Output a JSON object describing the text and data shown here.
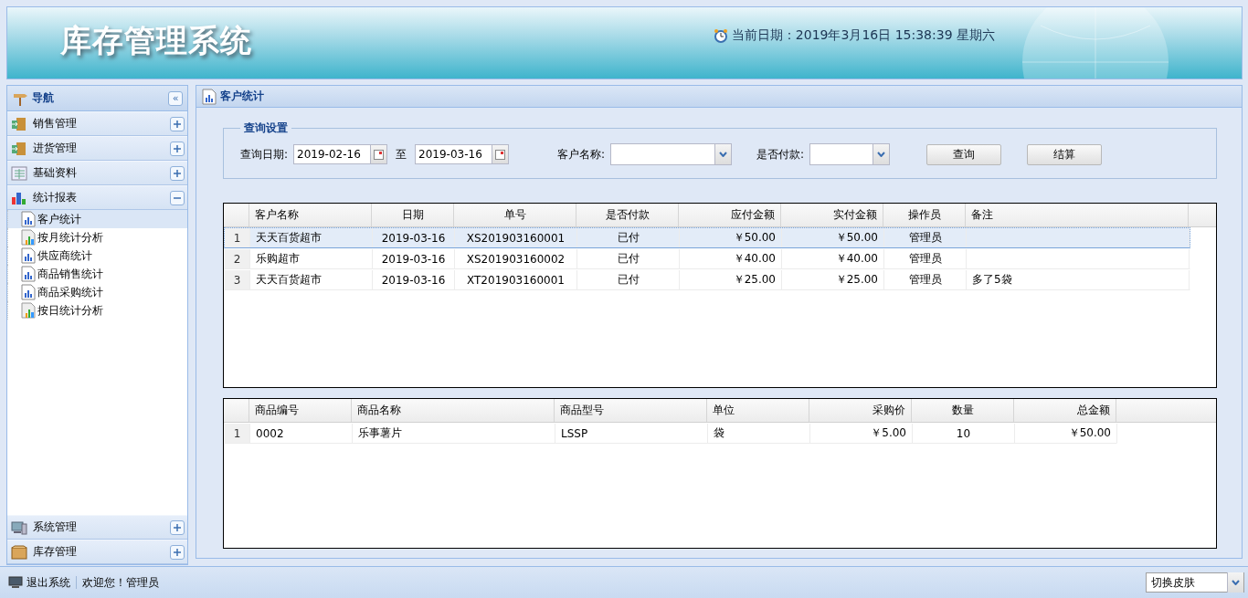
{
  "header": {
    "title": "库存管理系统",
    "date_label": "当前日期：2019年3月16日 15:38:39 星期六"
  },
  "sidebar": {
    "title": "导航",
    "collapse_glyph": "«",
    "groups": [
      {
        "label": "销售管理",
        "expanded": false
      },
      {
        "label": "进货管理",
        "expanded": false
      },
      {
        "label": "基础资料",
        "expanded": false
      },
      {
        "label": "统计报表",
        "expanded": true,
        "children": [
          {
            "label": "客户统计",
            "selected": true
          },
          {
            "label": "按月统计分析",
            "selected": false
          },
          {
            "label": "供应商统计",
            "selected": false
          },
          {
            "label": "商品销售统计",
            "selected": false
          },
          {
            "label": "商品采购统计",
            "selected": false
          },
          {
            "label": "按日统计分析",
            "selected": false
          }
        ]
      },
      {
        "label": "系统管理",
        "expanded": false
      },
      {
        "label": "库存管理",
        "expanded": false
      }
    ]
  },
  "panel": {
    "title": "客户统计",
    "query": {
      "legend": "查询设置",
      "date_label": "查询日期:",
      "date_from": "2019-02-16",
      "to_label": "至",
      "date_to": "2019-03-16",
      "customer_label": "客户名称:",
      "paid_label": "是否付款:",
      "buttons": [
        "查询",
        "结算"
      ]
    },
    "orders": {
      "columns": [
        "客户名称",
        "日期",
        "单号",
        "是否付款",
        "应付金额",
        "实付金额",
        "操作员",
        "备注"
      ],
      "rows": [
        {
          "index": "1",
          "selected": true,
          "cells": [
            "天天百货超市",
            "2019-03-16",
            "XS201903160001",
            "已付",
            "￥50.00",
            "￥50.00",
            "管理员",
            ""
          ]
        },
        {
          "index": "2",
          "selected": false,
          "cells": [
            "乐购超市",
            "2019-03-16",
            "XS201903160002",
            "已付",
            "￥40.00",
            "￥40.00",
            "管理员",
            ""
          ]
        },
        {
          "index": "3",
          "selected": false,
          "cells": [
            "天天百货超市",
            "2019-03-16",
            "XT201903160001",
            "已付",
            "￥25.00",
            "￥25.00",
            "管理员",
            "多了5袋"
          ]
        }
      ]
    },
    "items": {
      "columns": [
        "商品编号",
        "商品名称",
        "商品型号",
        "单位",
        "采购价",
        "数量",
        "总金额"
      ],
      "rows": [
        {
          "index": "1",
          "selected": false,
          "cells": [
            "0002",
            "乐事薯片",
            "LSSP",
            "袋",
            "￥5.00",
            "10",
            "￥50.00"
          ]
        }
      ]
    }
  },
  "status_bar": {
    "logout": "退出系统",
    "welcome": "欢迎您！管理员",
    "skin_select": "切换皮肤"
  }
}
